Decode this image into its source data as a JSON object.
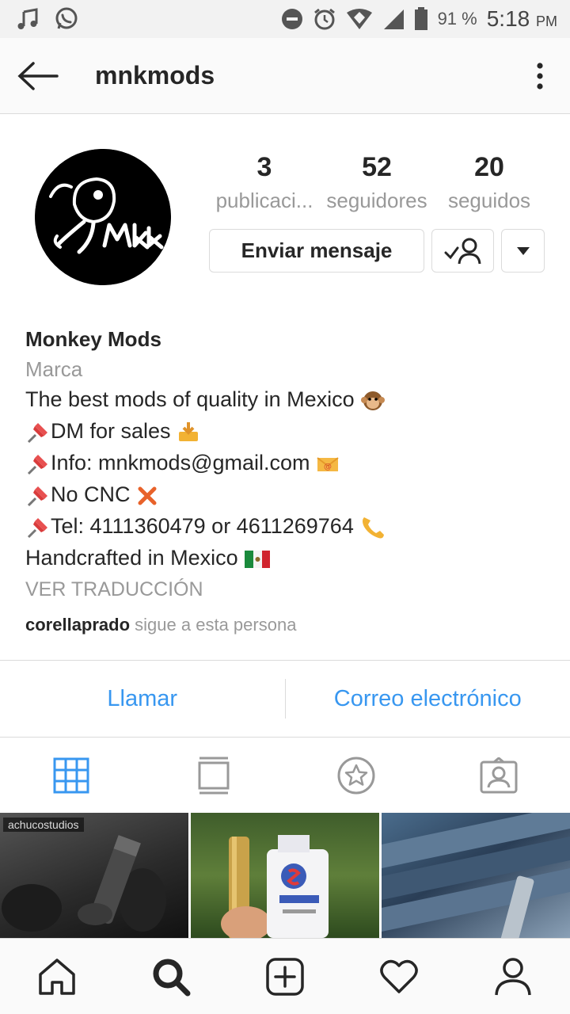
{
  "status_bar": {
    "battery": "91 %",
    "time": "5:18",
    "ampm": "PM"
  },
  "header": {
    "username": "mnkmods"
  },
  "profile": {
    "posts_count": "3",
    "posts_label": "publicaci...",
    "followers_count": "52",
    "followers_label": "seguidores",
    "following_count": "20",
    "following_label": "seguidos",
    "message_button": "Enviar mensaje"
  },
  "bio": {
    "name": "Monkey Mods",
    "category": "Marca",
    "line1": "The best mods of quality in Mexico",
    "line2": "DM for sales",
    "line3": "Info: mnkmods@gmail.com",
    "line4": "No CNC",
    "line5": "Tel: 4111360479 or 4611269764",
    "line6": "Handcrafted in Mexico",
    "translate": "VER TRADUCCIÓN",
    "followed_by_user": "corellaprado",
    "followed_by_text": "sigue a esta persona"
  },
  "contacts": {
    "call": "Llamar",
    "email": "Correo electrónico"
  },
  "grid": {
    "watermark": "achucostudios"
  },
  "colors": {
    "accent": "#3897f0",
    "border": "#dbdbdb",
    "muted": "#999999"
  }
}
